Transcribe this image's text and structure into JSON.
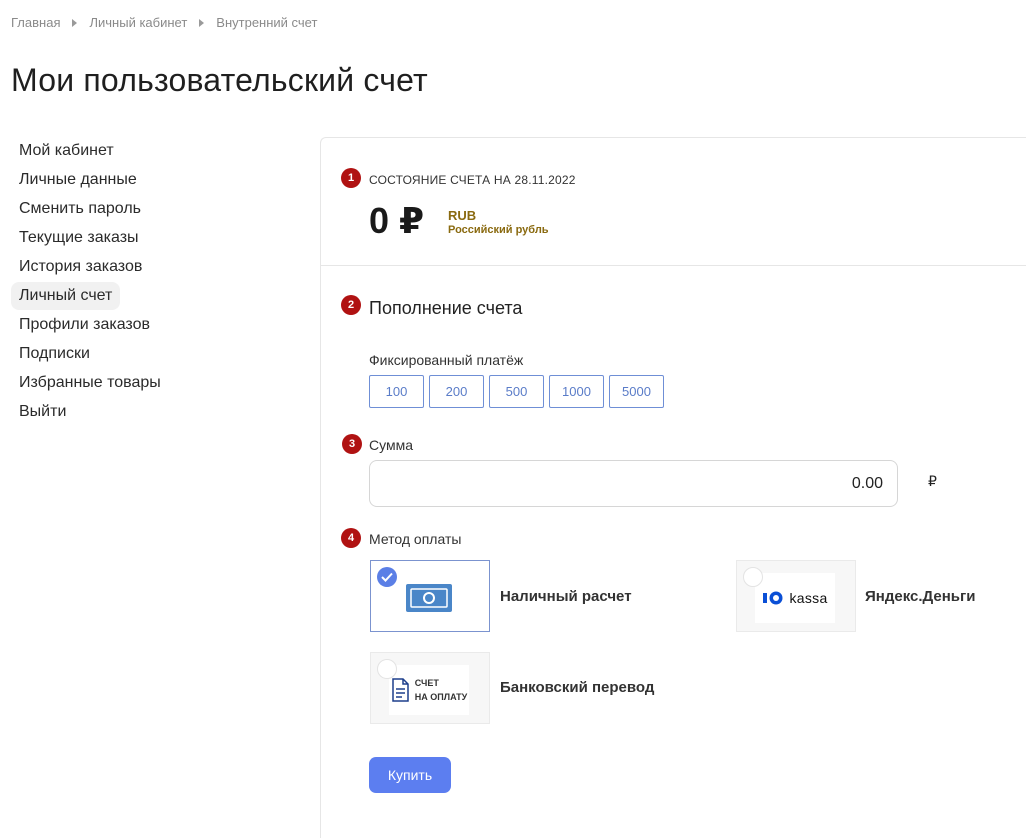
{
  "breadcrumb": [
    "Главная",
    "Личный кабинет",
    "Внутренний счет"
  ],
  "page_title": "Мои пользовательский счет",
  "sidebar": {
    "items": [
      {
        "label": "Мой кабинет"
      },
      {
        "label": "Личные данные"
      },
      {
        "label": "Сменить пароль"
      },
      {
        "label": "Текущие заказы"
      },
      {
        "label": "История заказов"
      },
      {
        "label": "Личный счет",
        "active": true
      },
      {
        "label": "Профили заказов"
      },
      {
        "label": "Подписки"
      },
      {
        "label": "Избранные товары"
      },
      {
        "label": "Выйти"
      }
    ]
  },
  "steps": [
    "1",
    "2",
    "3",
    "4"
  ],
  "account": {
    "state_label": "СОСТОЯНИЕ СЧЕТА НА 28.11.2022",
    "balance": "0 ₽",
    "currency_code": "RUB",
    "currency_name": "Российский рубль"
  },
  "topup": {
    "title": "Пополнение счета",
    "fixed_label": "Фиксированный платёж",
    "amounts": [
      "100",
      "200",
      "500",
      "1000",
      "5000"
    ],
    "sum_label": "Сумма",
    "sum_value": "0.00",
    "sum_currency": "₽"
  },
  "payment": {
    "label": "Метод оплаты",
    "methods": [
      {
        "name": "Наличный расчет",
        "icon": "cash-icon",
        "selected": true
      },
      {
        "name": "Яндекс.Деньги",
        "icon": "yookassa-logo",
        "logo_text": "kassa",
        "selected": false
      },
      {
        "name": "Банковский перевод",
        "icon": "invoice-icon",
        "logo_text_1": "СЧЕТ",
        "logo_text_2": "НА ОПЛАТУ",
        "selected": false
      }
    ]
  },
  "buy_label": "Купить",
  "colors": {
    "accent": "#5c7ef0",
    "step_badge": "#b01212",
    "currency_text": "#8a6a10"
  }
}
